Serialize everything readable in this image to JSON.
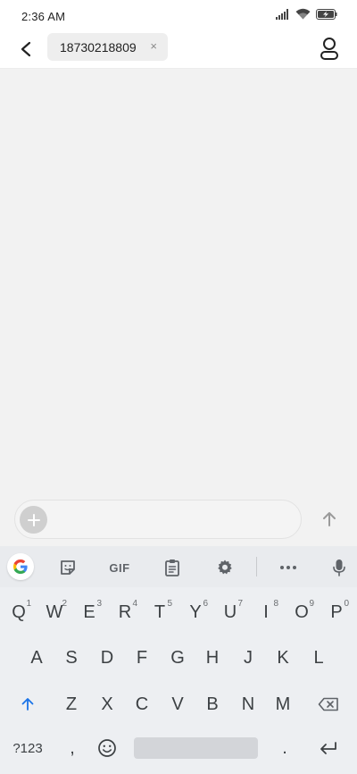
{
  "status_bar": {
    "time": "2:36 AM",
    "icons": [
      "signal-icon",
      "wifi-icon",
      "battery-charging-icon"
    ]
  },
  "header": {
    "back_icon": "back-arrow-icon",
    "recipient": "18730218809",
    "clear_symbol": "×",
    "contact_icon": "person-icon"
  },
  "compose": {
    "add_icon": "plus-icon",
    "placeholder": "",
    "send_icon": "arrow-up-icon"
  },
  "keyboard": {
    "toolbar": {
      "gif_label": "GIF",
      "items": [
        "google-icon",
        "sticker-icon",
        "gif-icon",
        "clipboard-icon",
        "gear-icon",
        "more-icon",
        "microphone-icon"
      ]
    },
    "row1": [
      "Q",
      "W",
      "E",
      "R",
      "T",
      "Y",
      "U",
      "I",
      "O",
      "P"
    ],
    "row1_hints": [
      "1",
      "2",
      "3",
      "4",
      "5",
      "6",
      "7",
      "8",
      "9",
      "0"
    ],
    "row2": [
      "A",
      "S",
      "D",
      "F",
      "G",
      "H",
      "J",
      "K",
      "L"
    ],
    "row3": [
      "Z",
      "X",
      "C",
      "V",
      "B",
      "N",
      "M"
    ],
    "symbols_label": "?123",
    "comma_label": ",",
    "period_label": ".",
    "shift_icon": "shift-arrow-icon",
    "backspace_icon": "backspace-icon",
    "emoji_icon": "emoji-icon",
    "enter_icon": "enter-icon"
  },
  "colors": {
    "conversation_bg": "#f2f2f2",
    "keyboard_bg": "#edeff2",
    "shift_accent": "#1a73e8"
  }
}
